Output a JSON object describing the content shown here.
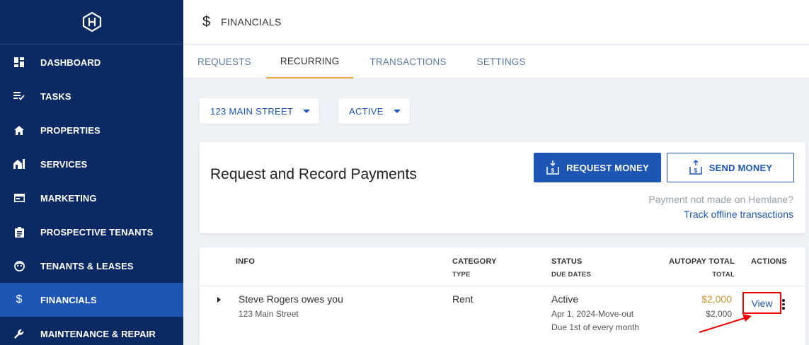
{
  "sidebar": {
    "items": [
      {
        "label": "DASHBOARD",
        "icon": "dashboard-icon"
      },
      {
        "label": "TASKS",
        "icon": "tasks-icon"
      },
      {
        "label": "PROPERTIES",
        "icon": "home-icon"
      },
      {
        "label": "SERVICES",
        "icon": "services-icon"
      },
      {
        "label": "MARKETING",
        "icon": "marketing-icon"
      },
      {
        "label": "PROSPECTIVE TENANTS",
        "icon": "clipboard-icon"
      },
      {
        "label": "TENANTS & LEASES",
        "icon": "tenant-face-icon"
      },
      {
        "label": "FINANCIALS",
        "icon": "dollar-icon",
        "active": true
      },
      {
        "label": "MAINTENANCE & REPAIR",
        "icon": "wrench-icon"
      }
    ]
  },
  "header": {
    "icon_glyph": "$",
    "title": "FINANCIALS"
  },
  "tabs": [
    "REQUESTS",
    "RECURRING",
    "TRANSACTIONS",
    "SETTINGS"
  ],
  "active_tab": "RECURRING",
  "filters": {
    "property": "123 MAIN STREET",
    "status": "ACTIVE"
  },
  "card": {
    "title": "Request and Record Payments",
    "request_button": "REQUEST MONEY",
    "send_button": "SEND MONEY",
    "offline_question": "Payment not made on Hemlane?",
    "offline_link": "Track offline transactions"
  },
  "table": {
    "headers": {
      "info": "INFO",
      "category": "CATEGORY",
      "category_sub": "TYPE",
      "status": "STATUS",
      "status_sub": "DUE DATES",
      "autopay": "AUTOPAY TOTAL",
      "autopay_sub": "TOTAL",
      "actions": "ACTIONS"
    },
    "rows": [
      {
        "name": "Steve Rogers owes you",
        "address": "123 Main Street",
        "category": "Rent",
        "status": "Active",
        "due_dates": "Apr 1, 2024-Move-out",
        "due_rule": "Due 1st of every month",
        "autopay_total": "$2,000",
        "total": "$2,000",
        "action": "View"
      }
    ]
  },
  "colors": {
    "sidebar_bg": "#0b2a63",
    "accent": "#1e56b5",
    "tab_underline": "#e6a33e",
    "autopay_amount": "#c9922e",
    "highlight": "#e00000"
  }
}
